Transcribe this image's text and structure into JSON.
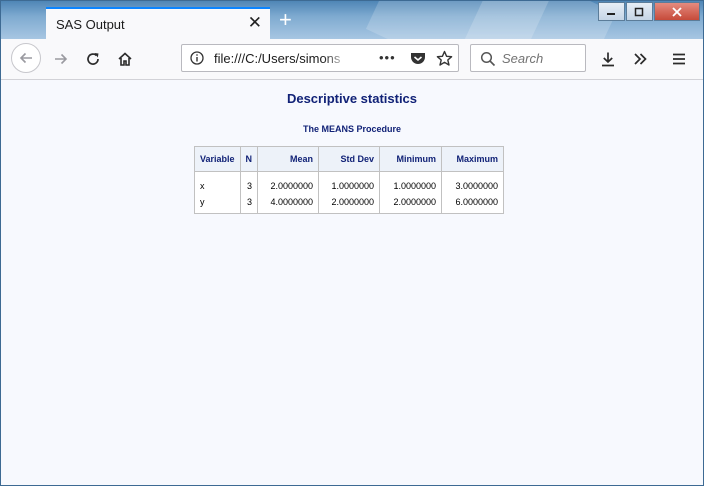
{
  "browser": {
    "tab_title": "SAS Output",
    "url": "file:///C:/Users/simons",
    "search_placeholder": "Search",
    "page_actions_glyph": "•••"
  },
  "page": {
    "title": "Descriptive statistics",
    "procedure_title": "The MEANS Procedure",
    "table": {
      "columns": [
        "Variable",
        "N",
        "Mean",
        "Std Dev",
        "Minimum",
        "Maximum"
      ],
      "rows": [
        [
          "x",
          "3",
          "2.0000000",
          "1.0000000",
          "1.0000000",
          "3.0000000"
        ],
        [
          "y",
          "3",
          "4.0000000",
          "2.0000000",
          "2.0000000",
          "6.0000000"
        ]
      ]
    }
  },
  "colors": {
    "title_blue": "#112277",
    "tab_accent": "#0a84ff",
    "header_bg": "#edf2f9"
  }
}
